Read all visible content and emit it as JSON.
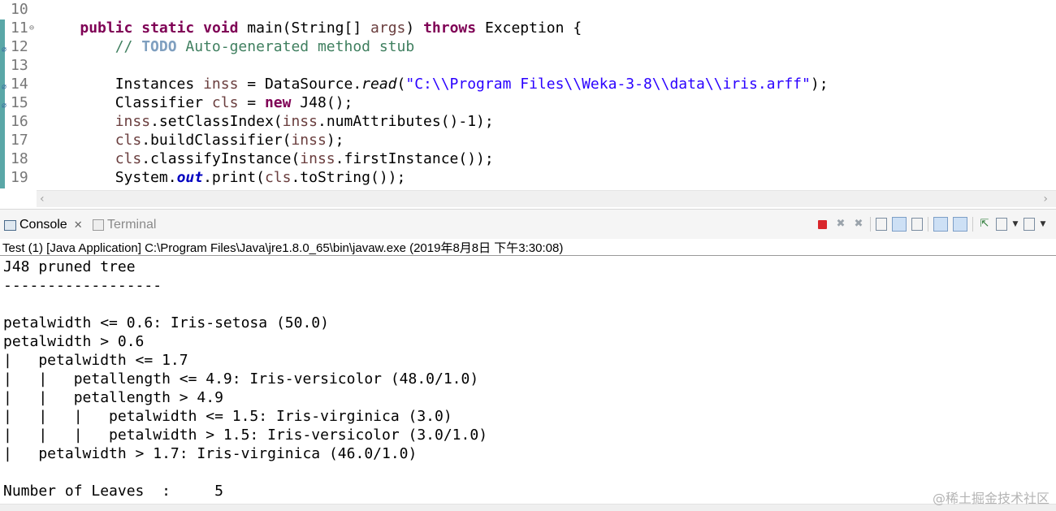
{
  "editor": {
    "lines": [
      {
        "num": "10"
      },
      {
        "num": "11",
        "fold": "⊖",
        "indent": "    ",
        "tokens": [
          {
            "c": "kw",
            "t": "public"
          },
          {
            "c": "",
            "t": " "
          },
          {
            "c": "kw",
            "t": "static"
          },
          {
            "c": "",
            "t": " "
          },
          {
            "c": "kw",
            "t": "void"
          },
          {
            "c": "",
            "t": " main(String[] "
          },
          {
            "c": "var",
            "t": "args"
          },
          {
            "c": "",
            "t": ") "
          },
          {
            "c": "kw",
            "t": "throws"
          },
          {
            "c": "",
            "t": " Exception {"
          }
        ]
      },
      {
        "num": "12",
        "marker": "⌀",
        "indent": "        ",
        "tokens": [
          {
            "c": "cm",
            "t": "// "
          },
          {
            "c": "todo",
            "t": "TODO"
          },
          {
            "c": "cm",
            "t": " Auto-generated method stub"
          }
        ]
      },
      {
        "num": "13"
      },
      {
        "num": "14",
        "marker": "⌀",
        "indent": "        ",
        "tokens": [
          {
            "c": "",
            "t": "Instances "
          },
          {
            "c": "var",
            "t": "inss"
          },
          {
            "c": "",
            "t": " = DataSource."
          },
          {
            "c": "ital",
            "t": "read"
          },
          {
            "c": "",
            "t": "("
          },
          {
            "c": "st",
            "t": "\"C:\\\\Program Files\\\\Weka-3-8\\\\data\\\\iris.arff\""
          },
          {
            "c": "",
            "t": ");"
          }
        ]
      },
      {
        "num": "15",
        "marker": "⌀",
        "indent": "        ",
        "tokens": [
          {
            "c": "",
            "t": "Classifier "
          },
          {
            "c": "var",
            "t": "cls"
          },
          {
            "c": "",
            "t": " = "
          },
          {
            "c": "kw",
            "t": "new"
          },
          {
            "c": "",
            "t": " J48();"
          }
        ]
      },
      {
        "num": "16",
        "indent": "        ",
        "tokens": [
          {
            "c": "var",
            "t": "inss"
          },
          {
            "c": "",
            "t": ".setClassIndex("
          },
          {
            "c": "var",
            "t": "inss"
          },
          {
            "c": "",
            "t": ".numAttributes()-1);"
          }
        ]
      },
      {
        "num": "17",
        "indent": "        ",
        "tokens": [
          {
            "c": "var",
            "t": "cls"
          },
          {
            "c": "",
            "t": ".buildClassifier("
          },
          {
            "c": "var",
            "t": "inss"
          },
          {
            "c": "",
            "t": ");"
          }
        ]
      },
      {
        "num": "18",
        "indent": "        ",
        "tokens": [
          {
            "c": "var",
            "t": "cls"
          },
          {
            "c": "",
            "t": ".classifyInstance("
          },
          {
            "c": "var",
            "t": "inss"
          },
          {
            "c": "",
            "t": ".firstInstance());"
          }
        ]
      },
      {
        "num": "19",
        "indent": "        ",
        "tokens": [
          {
            "c": "",
            "t": "System."
          },
          {
            "c": "fld",
            "t": "out"
          },
          {
            "c": "",
            "t": ".print("
          },
          {
            "c": "var",
            "t": "cls"
          },
          {
            "c": "",
            "t": ".toString());"
          }
        ]
      }
    ]
  },
  "tabs": {
    "console_label": "Console",
    "console_close": "✕",
    "terminal_label": "Terminal"
  },
  "toolbar_icons": [
    "stop-icon",
    "remove-launch-icon",
    "remove-all-icon",
    "clear-console-icon",
    "scroll-lock-icon",
    "word-wrap-icon",
    "show-on-stdout-icon",
    "show-on-stderr-icon",
    "pin-console-icon",
    "display-console-icon",
    "open-console-icon"
  ],
  "console": {
    "launch_info": "Test (1) [Java Application] C:\\Program Files\\Java\\jre1.8.0_65\\bin\\javaw.exe (2019年8月8日 下午3:30:08)",
    "output_lines": [
      "J48 pruned tree",
      "------------------",
      "",
      "petalwidth <= 0.6: Iris-setosa (50.0)",
      "petalwidth > 0.6",
      "|   petalwidth <= 1.7",
      "|   |   petallength <= 4.9: Iris-versicolor (48.0/1.0)",
      "|   |   petallength > 4.9",
      "|   |   |   petalwidth <= 1.5: Iris-virginica (3.0)",
      "|   |   |   petalwidth > 1.5: Iris-versicolor (3.0/1.0)",
      "|   petalwidth > 1.7: Iris-virginica (46.0/1.0)",
      "",
      "Number of Leaves  :     5"
    ]
  },
  "watermark": "@稀土掘金技术社区",
  "colors": {
    "keyword": "#7f0055",
    "comment": "#3f7f5f",
    "string": "#2a00ff",
    "local_var": "#6a3e3e",
    "gutter_change_bar": "#5aa7a7",
    "stop_button": "#d9262b"
  }
}
